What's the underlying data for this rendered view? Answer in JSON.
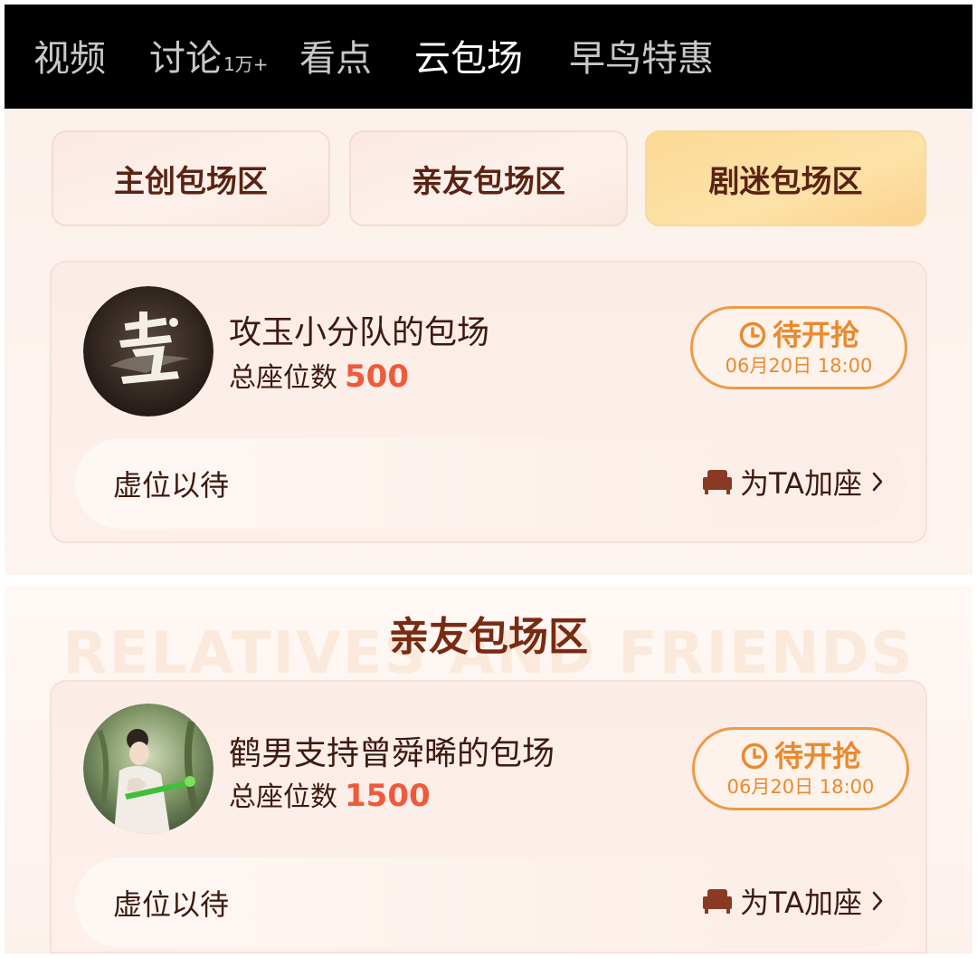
{
  "nav": {
    "items": [
      {
        "label": "视频"
      },
      {
        "label": "讨论",
        "badge": "1万+"
      },
      {
        "label": "看点"
      },
      {
        "label": "云包场"
      },
      {
        "label": "早鸟特惠"
      }
    ],
    "active_index": 3
  },
  "zones": {
    "tabs": [
      {
        "label": "主创包场区"
      },
      {
        "label": "亲友包场区"
      },
      {
        "label": "剧迷包场区"
      }
    ],
    "active_index": 2
  },
  "cards": [
    {
      "title": "攻玉小分队的包场",
      "seat_label": "总座位数",
      "seat_count": "500",
      "status": "待开抢",
      "time": "06月20日 18:00",
      "empty_text": "虚位以待",
      "add_seat": "为TA加座"
    },
    {
      "title": "鹤男支持曾舜晞的包场",
      "seat_label": "总座位数",
      "seat_count": "1500",
      "status": "待开抢",
      "time": "06月20日 18:00",
      "empty_text": "虚位以待",
      "add_seat": "为TA加座"
    }
  ],
  "section": {
    "title": "亲友包场区",
    "watermark": "RELATIVES AND FRIENDS"
  },
  "colors": {
    "accent_orange": "#e98a2f",
    "seat_count_red": "#ee5a3a",
    "active_tab_gold": "#fbd995",
    "title_brown": "#7a2a12"
  },
  "icons": [
    "clock-icon",
    "sofa-icon",
    "chevron-right-icon"
  ]
}
